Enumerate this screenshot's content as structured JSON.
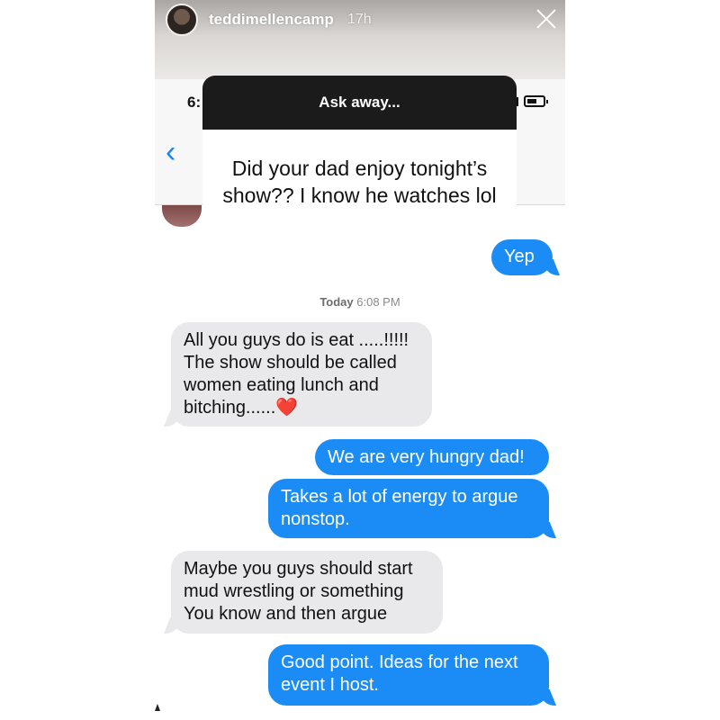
{
  "story": {
    "username": "teddimellencamp",
    "time_ago": "17h"
  },
  "phone": {
    "status_time": "6:",
    "back_icon": "chevron-left-icon"
  },
  "question_sticker": {
    "header": "Ask away...",
    "question": "Did your dad enjoy tonight’s show?? I know he watches lol"
  },
  "messages": {
    "first_reply": "Yep",
    "timestamp_day": "Today",
    "timestamp_time": "6:08 PM",
    "m1_line1": "All you guys do is eat .....!!!!!",
    "m1_line2": "The show should be called",
    "m1_line3": "women eating lunch and",
    "m1_line4": "bitching......",
    "m1_emoji": "❤️",
    "m2": "We are very hungry dad!",
    "m3_line1": "Takes a lot of energy to argue",
    "m3_line2": "nonstop.",
    "m4_line1": "Maybe you guys should start",
    "m4_line2": "mud wrestling or something",
    "m4_line3": "You know and then argue",
    "m5_line1": "Good point. Ideas for the next",
    "m5_line2": "event I host."
  },
  "colors": {
    "sent_bubble": "#1b8cf5",
    "received_bubble": "#e9e9eb",
    "sticker_header": "#1b1b1b",
    "ios_blue": "#1a82f7"
  }
}
